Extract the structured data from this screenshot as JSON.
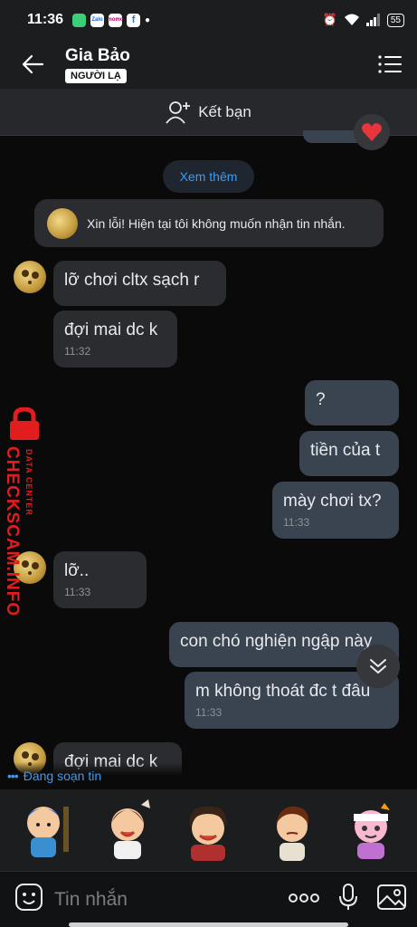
{
  "status_bar": {
    "time": "11:36",
    "apps": [
      "Zalo",
      "momo",
      "f"
    ],
    "battery": "55"
  },
  "header": {
    "name": "Gia Bảo",
    "badge": "NGƯỜI LẠ",
    "back_icon": "arrow-left-icon",
    "menu_icon": "list-icon"
  },
  "friend_bar": {
    "label": "Kết bạn",
    "icon": "add-person-icon"
  },
  "see_more": "Xem thêm",
  "system_message": "Xin lỗi! Hiện tại tôi không muốn nhận tin nhắn.",
  "messages": [
    {
      "side": "in",
      "text": "lỡ chơi cltx sạch r",
      "time": ""
    },
    {
      "side": "in",
      "text": "đợi mai dc k",
      "time": "11:32"
    },
    {
      "side": "out",
      "text": "?",
      "time": ""
    },
    {
      "side": "out",
      "text": "tiền của t",
      "time": ""
    },
    {
      "side": "out",
      "text": "mày chơi tx?",
      "time": "11:33"
    },
    {
      "side": "in",
      "text": "lỡ..",
      "time": "11:33"
    },
    {
      "side": "out",
      "text": "con chó nghiện ngập này",
      "time": ""
    },
    {
      "side": "out",
      "text": "m không thoát đc t đâu",
      "time": "11:33"
    },
    {
      "side": "in",
      "text": "đợi mai dc k",
      "time": ""
    }
  ],
  "watermark": {
    "main": "CHECKSCAM.INFO",
    "sub": "DATA CENTER"
  },
  "typing_indicator": "Đang soạn tin",
  "composer": {
    "placeholder": "Tin nhắn"
  },
  "colors": {
    "background": "#0a0a0b",
    "incoming_bubble": "#2b2c30",
    "outgoing_bubble": "#3a4350",
    "accent": "#3a9cf5",
    "watermark": "#e11d1d"
  }
}
